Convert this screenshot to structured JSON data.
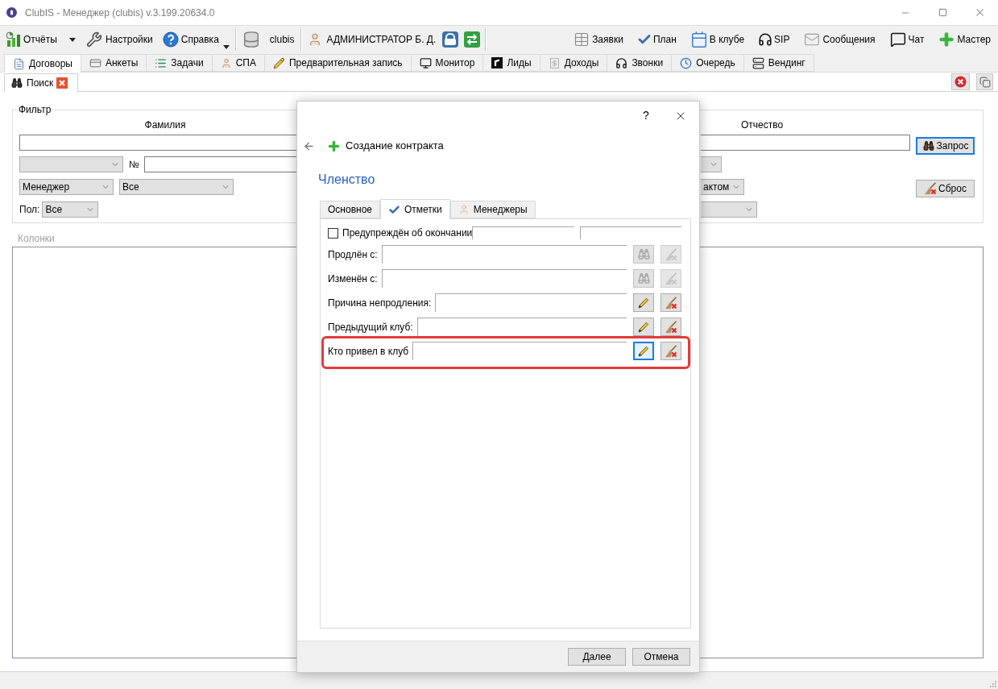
{
  "window": {
    "title": "ClubIS - Менеджер (clubis) v.3.199.20634.0"
  },
  "toolbar": {
    "groups": [
      [
        {
          "label": "Отчёты",
          "kind": "dropdown"
        },
        {
          "label": "Настройки",
          "kind": "button"
        },
        {
          "label": "Справка",
          "kind": "menu"
        }
      ],
      [
        {
          "label": "clubis",
          "kind": "button"
        }
      ],
      [
        {
          "label": "АДМИНИСТРАТОР Б. Д.",
          "kind": "user"
        }
      ]
    ],
    "right": [
      {
        "label": "Заявки"
      },
      {
        "label": "План"
      },
      {
        "label": "В клубе"
      },
      {
        "label": "SIP"
      },
      {
        "label": "Сообщения"
      },
      {
        "label": "Чат"
      },
      {
        "label": "Мастер"
      }
    ]
  },
  "tabs": [
    {
      "label": "Договоры",
      "selected": true
    },
    {
      "label": "Анкеты",
      "selected": false
    },
    {
      "label": "Задачи",
      "selected": false
    },
    {
      "label": "СПА",
      "selected": false
    },
    {
      "label": "Предварительная запись",
      "selected": false
    },
    {
      "label": "Монитор",
      "selected": false
    },
    {
      "label": "Лиды",
      "selected": false
    },
    {
      "label": "Доходы",
      "selected": false
    },
    {
      "label": "Звонки",
      "selected": false
    },
    {
      "label": "Очередь",
      "selected": false
    },
    {
      "label": "Вендинг",
      "selected": false
    }
  ],
  "subtabs": [
    {
      "label": "Поиск",
      "selected": true,
      "closable": true
    }
  ],
  "filter": {
    "title": "Фильтр",
    "surname_label": "Фамилия",
    "patronymic_label": "Отчество",
    "number_label": "№",
    "manager_field": "Менеджер",
    "manager_value": "Все",
    "contact_value": "актом",
    "gender_label": "Пол:",
    "gender_value": "Все",
    "query_button": {
      "label": "Запрос",
      "focused": true
    },
    "reset_button": {
      "label": "Сброс"
    }
  },
  "columns": {
    "title": "Колонки"
  },
  "dialog": {
    "help": "?",
    "header": "Создание контракта",
    "section": "Членство",
    "tabs": [
      {
        "label": "Основное",
        "selected": false
      },
      {
        "label": "Отметки",
        "selected": true
      },
      {
        "label": "Менеджеры",
        "selected": false
      }
    ],
    "warned": {
      "label": "Предупреждён об окончании",
      "checked": false
    },
    "fields": [
      {
        "label": "Продлён с:",
        "kind": "date",
        "focused": false,
        "highlighted": false
      },
      {
        "label": "Изменён с:",
        "kind": "date",
        "focused": false,
        "highlighted": false
      },
      {
        "label": "Причина непродления:",
        "kind": "text",
        "focused": false,
        "highlighted": false
      },
      {
        "label": "Предыдущий клуб:",
        "kind": "text",
        "focused": false,
        "highlighted": false
      },
      {
        "label": "Кто привел в клуб",
        "kind": "text",
        "focused": true,
        "highlighted": true
      }
    ],
    "buttons": [
      "Далее",
      "Отмена"
    ]
  }
}
